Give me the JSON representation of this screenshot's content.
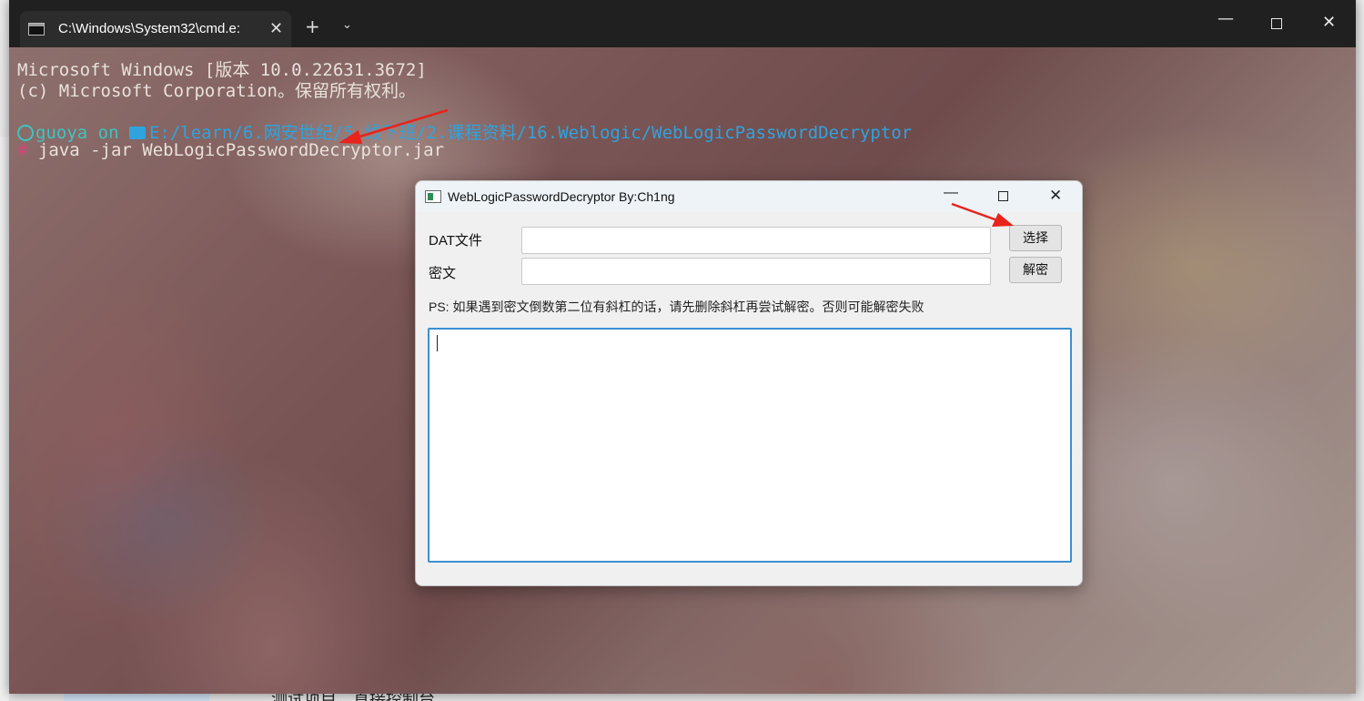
{
  "terminal": {
    "tab_title": "C:\\Windows\\System32\\cmd.e:",
    "tab_close_glyph": "✕",
    "new_tab_glyph": "+",
    "dropdown_glyph": "⌄",
    "min_glyph": "—",
    "close_glyph": "✕",
    "line1": "Microsoft Windows [版本 10.0.22631.3672]",
    "line2": "(c) Microsoft Corporation。保留所有权利。",
    "prompt_user": "guoya on",
    "prompt_path": "E:/learn/6.网安世纪/5.线下班/2.课程资料/16.Weblogic/WebLogicPasswordDecryptor",
    "prompt_hash": "#",
    "command": " java -jar WebLogicPasswordDecryptor.jar"
  },
  "dialog": {
    "title": "WebLogicPasswordDecryptor By:Ch1ng",
    "min_glyph": "—",
    "close_glyph": "✕",
    "dat_label": "DAT文件",
    "dat_value": "",
    "cipher_label": "密文",
    "cipher_value": "",
    "choose_button": "选择",
    "decrypt_button": "解密",
    "ps_text": "PS: 如果遇到密文倒数第二位有斜杠的话，请先删除斜杠再尝试解密。否则可能解密失败",
    "output_text": ""
  },
  "desktop": {
    "bottom_text": "测试项目，直接控制台"
  },
  "colors": {
    "annotation": "#e8231c",
    "prompt_user": "#3ec4c1",
    "prompt_path": "#2fa3de",
    "prompt_hash": "#d6447a",
    "output_focus_border": "#3c8fd0"
  },
  "icons": [
    "terminal-icon",
    "folder-icon",
    "user-icon",
    "app-icon"
  ]
}
